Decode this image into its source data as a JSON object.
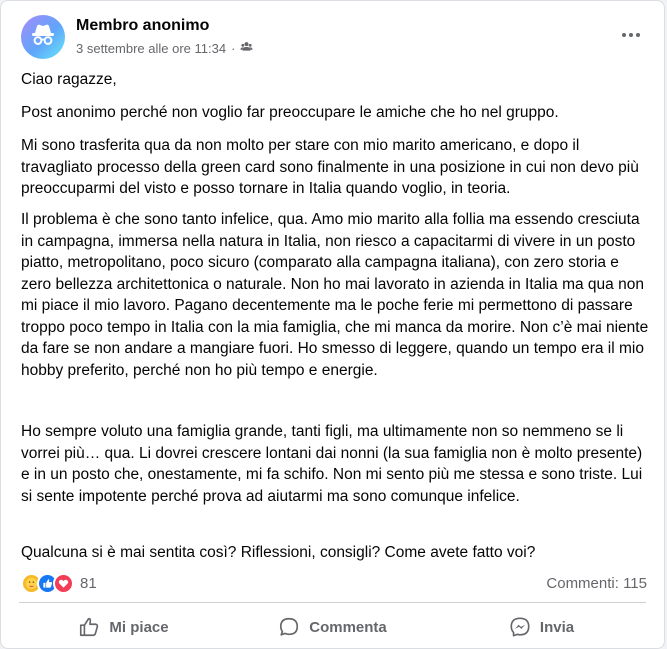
{
  "post": {
    "author": "Membro anonimo",
    "timestamp": "3 settembre alle ore 11:34",
    "separator": "·",
    "privacy_icon": "group-privacy-icon",
    "paragraphs": [
      "Ciao ragazze,",
      "Post anonimo perché non voglio far preoccupare le amiche che ho nel gruppo.",
      "Mi sono trasferita qua da non molto per stare con mio marito americano, e dopo il travagliato processo della green card sono finalmente in una posizione in cui non devo più preoccuparmi del visto e posso tornare in Italia quando voglio, in teoria.",
      "Il problema è che sono tanto infelice, qua. Amo mio marito alla follia ma essendo cresciuta in campagna, immersa nella natura in Italia, non riesco a capacitarmi di vivere in un posto piatto, metropolitano, poco sicuro (comparato alla campagna italiana), con zero storia e zero bellezza architettonica o naturale. Non ho mai lavorato in azienda in Italia ma qua non mi piace il mio lavoro. Pagano decentemente ma le poche ferie mi permettono di passare troppo poco tempo in Italia con la mia famiglia, che mi manca da morire. Non c’è mai niente da fare se non andare a mangiare fuori. Ho smesso di leggere, quando un tempo era il mio hobby preferito, perché non ho più tempo e energie.",
      "Ho sempre voluto una famiglia grande, tanti figli, ma ultimamente non so nemmeno se li vorrei più… qua. Li dovrei crescere lontani dai nonni (la sua famiglia non è molto presente) e in un posto che, onestamente, mi fa schifo. Non mi sento più me stessa e sono triste. Lui si sente impotente perché prova ad aiutarmi ma sono comunque infelice.",
      "Qualcuna si è mai sentita così? Riflessioni, consigli? Come avete fatto voi?"
    ]
  },
  "stats": {
    "reaction_icons": [
      "care-icon",
      "like-icon",
      "love-icon"
    ],
    "reaction_count": "81",
    "comments_label": "Commenti: 115"
  },
  "actions": {
    "like": "Mi piace",
    "comment": "Commenta",
    "share": "Invia"
  },
  "colors": {
    "text_primary": "#050505",
    "text_secondary": "#65676b",
    "like_blue": "#1877f2",
    "love_red": "#f33e58",
    "care_yellow": "#f7b928"
  }
}
